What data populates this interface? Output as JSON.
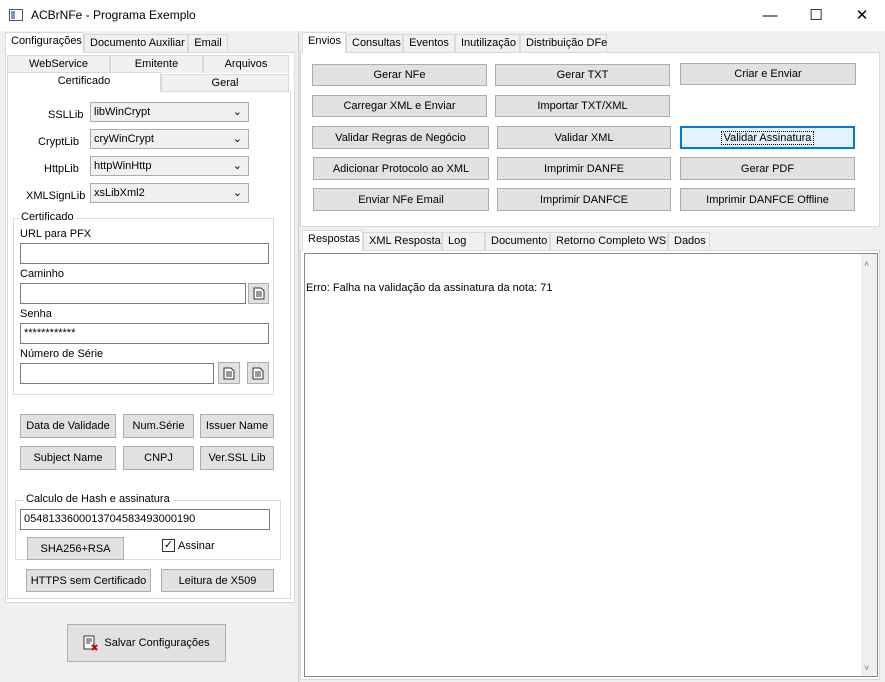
{
  "window": {
    "title": "ACBrNFe - Programa Exemplo",
    "minimize": "—",
    "maximize": "☐",
    "close": "✕"
  },
  "left": {
    "tabs_top": [
      "Configurações",
      "Documento Auxiliar",
      "Email"
    ],
    "tabs_row2": [
      "WebService",
      "Emitente",
      "Arquivos"
    ],
    "tabs_row3": [
      "Certificado",
      "Geral"
    ],
    "ssl": {
      "ssllib_label": "SSLLib",
      "ssllib_value": "libWinCrypt",
      "cryptlib_label": "CryptLib",
      "cryptlib_value": "cryWinCrypt",
      "httplib_label": "HttpLib",
      "httplib_value": "httpWinHttp",
      "xmlsignlib_label": "XMLSignLib",
      "xmlsignlib_value": "xsLibXml2"
    },
    "certificado": {
      "group_title": "Certificado",
      "url_label": "URL para PFX",
      "url_value": "",
      "caminho_label": "Caminho",
      "caminho_value": "",
      "senha_label": "Senha",
      "senha_value": "************",
      "serie_label": "Número de Série",
      "serie_value": ""
    },
    "buttons": {
      "data_validade": "Data de Validade",
      "num_serie": "Num.Série",
      "issuer_name": "Issuer Name",
      "subject_name": "Subject Name",
      "cnpj": "CNPJ",
      "ver_ssl_lib": "Ver.SSL Lib"
    },
    "hash": {
      "group_title": "Calculo de Hash e assinatura",
      "value": "05481336000137045834930001​90",
      "sha_button": "SHA256+RSA",
      "assinar_label": "Assinar",
      "assinar_checked": true
    },
    "https_button": "HTTPS sem Certificado",
    "leitura_button": "Leitura de X509",
    "salvar_button": "Salvar Configurações"
  },
  "right": {
    "tabs_top": [
      "Envios",
      "Consultas",
      "Eventos",
      "Inutilização",
      "Distribuição DFe"
    ],
    "buttons": [
      [
        "Gerar NFe",
        "Gerar TXT",
        "Criar e Enviar"
      ],
      [
        "Carregar XML e Enviar",
        "Importar TXT/XML",
        ""
      ],
      [
        "Validar Regras de Negócio",
        "Validar XML",
        "Validar Assinatura"
      ],
      [
        "Adicionar Protocolo ao XML",
        "Imprimir DANFE",
        "Gerar PDF"
      ],
      [
        "Enviar NFe Email",
        "Imprimir DANFCE",
        "Imprimir DANFCE Offline"
      ]
    ],
    "tabs_bottom": [
      "Respostas",
      "XML Resposta",
      "Log",
      "Documento",
      "Retorno Completo WS",
      "Dados"
    ],
    "response_text": "Erro: Falha na validação da assinatura da nota: 71"
  }
}
